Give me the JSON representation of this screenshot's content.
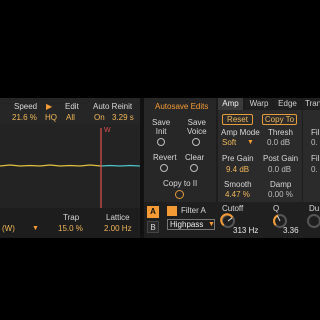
{
  "left_header": {
    "speed": {
      "label": "Speed",
      "value": "21.6 %"
    },
    "play": {
      "value": "HQ"
    },
    "edit": {
      "label": "Edit",
      "value": "All"
    },
    "auto_reinit": {
      "label": "Auto Reinit",
      "on": "On",
      "value": "3.29 s"
    }
  },
  "waveform": {
    "marker_label": "W"
  },
  "bottom_left": {
    "mode_value": "(W)",
    "trap": {
      "label": "Trap",
      "value": "15.0 %"
    },
    "lattice": {
      "label": "Lattice",
      "value": "2.00 Hz"
    }
  },
  "autosave": {
    "title": "Autosave Edits",
    "save_init": "Save\nInit",
    "save_voice": "Save\nVoice",
    "revert": "Revert",
    "clear": "Clear",
    "copy_to": "Copy to II"
  },
  "tabs": {
    "amp": "Amp",
    "warp": "Warp",
    "edge": "Edge",
    "next": "Tran"
  },
  "amp": {
    "reset": "Reset",
    "copy_to": "Copy To",
    "amp_mode": {
      "label": "Amp Mode",
      "value": "Soft"
    },
    "thresh": {
      "label": "Thresh",
      "value": "0.0 dB"
    },
    "pre_gain": {
      "label": "Pre Gain",
      "value": "9.4 dB"
    },
    "post_gain": {
      "label": "Post Gain",
      "value": "0.0 dB"
    },
    "smooth": {
      "label": "Smooth",
      "value": "4.47 %"
    },
    "damp": {
      "label": "Damp",
      "value": "0.00 %"
    },
    "right_partial": {
      "label_top": "Fil",
      "value_top": "0.",
      "label_mid": "Fil",
      "value_mid": "0."
    }
  },
  "filter": {
    "slot_a": "A",
    "slot_b": "B",
    "name": "Filter A",
    "type": "Highpass",
    "cutoff": {
      "label": "Cutoff",
      "value": "313 Hz"
    },
    "q": {
      "label": "Q",
      "value": "3.36"
    },
    "next_partial": "Du"
  },
  "colors": {
    "accent": "#f59b35",
    "trace_teal": "#4fc3c8",
    "trace_yellow": "#e0c040",
    "marker": "#e05050"
  }
}
